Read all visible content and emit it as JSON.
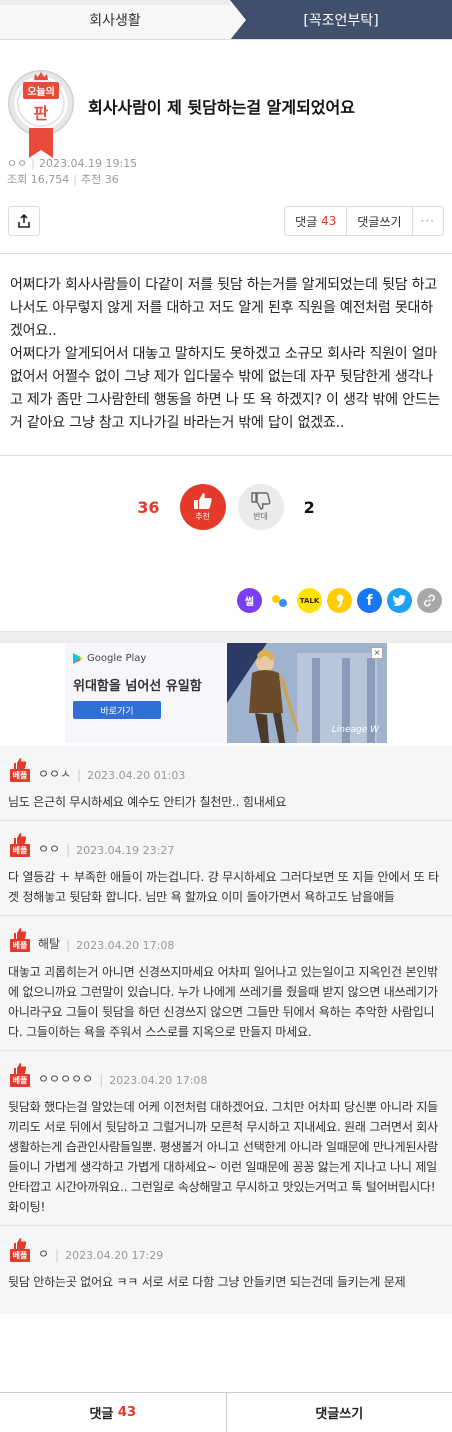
{
  "breadcrumb": {
    "category": "회사생활",
    "board": "[꼭조언부탁]"
  },
  "badge": {
    "line1": "오늘의",
    "line2": "판"
  },
  "post": {
    "title": "회사사람이 제 뒷담하는걸 알게되었어요",
    "author": "ㅇㅇ",
    "date": "2023.04.19 19:15",
    "views_label": "조회 16,754",
    "recommend_label": "추천 36",
    "body": "어쩌다가 회사사람들이 다같이 저를 뒷담 하는거를 알게되었는데 뒷담 하고 나서도 아무렇지 않게 저를 대하고 저도 알게 된후 직원을 예전처럼 못대하겠어요..\n어쩌다가 알게되어서 대놓고 말하지도 못하겠고 소규모 회사라 직원이 얼마 없어서 어쩔수 없이 그냥 제가 입다물수 밖에 없는데 자꾸 뒷담한게 생각나고 제가 좀만 그사람한테 행동을 하면 나 또 욕 하겠지? 이 생각 밖에 안드는거 같아요 그냥 참고 지나가길 바라는거 밖에 답이 없겠죠.."
  },
  "actions": {
    "comment_label": "댓글",
    "comment_count": "43",
    "write_label": "댓글쓰기",
    "more": "···"
  },
  "vote": {
    "up_count": "36",
    "up_label": "추천",
    "down_label": "반대",
    "down_count": "2"
  },
  "share": {
    "ssul": "썰",
    "kakao_talk": "TALK",
    "facebook": "f"
  },
  "ad": {
    "store": "Google Play",
    "headline": "위대함을 넘어선 유일함",
    "cta": "바로가기",
    "game": "Lineage W"
  },
  "best_tag": "베플",
  "comments": [
    {
      "nick": "ㅇㅇㅅ",
      "date": "2023.04.20 01:03",
      "text": "님도 은근히 무시하세요 예수도 안티가 칠천만.. 힘내세요"
    },
    {
      "nick": "ㅇㅇ",
      "date": "2023.04.19 23:27",
      "text": "다 열등감 ＋ 부족한 애들이 까는겁니다. 걍 무시하세요 그러다보면 또 지들 안에서 또 타겟 정해놓고 뒷담화 합니다. 님만 욕 할까요 이미 돌아가면서 욕하고도 남을애들"
    },
    {
      "nick": "해탈",
      "date": "2023.04.20 17:08",
      "text": "대놓고 괴롭히는거 아니면 신경쓰지마세요 어차피 일어나고 있는일이고 지옥인건 본인밖에 없으니까요 그런말이 있습니다. 누가 나에게 쓰레기를 줬을때 받지 않으면 내쓰레기가 아니라구요 그들이 뒷담을 하던 신경쓰지 않으면 그들만 뒤에서 욕하는 추악한 사람입니다. 그들이하는 욕을 주워서 스스로를 지옥으로 만들지 마세요."
    },
    {
      "nick": "ㅇㅇㅇㅇㅇ",
      "date": "2023.04.20 17:08",
      "text": "뒷담화 했다는걸 알았는데 어케 이전처럼 대하겠어요. 그치만 어차피 당신뿐 아니라 지들끼리도 서로 뒤에서 뒷담하고 그럴거니까 모른척 무시하고 지내세요. 원래 그러면서 회사생활하는게 습관인사람들일뿐. 평생볼거 아니고 선택한게 아니라 일때문에 만나게된사람들이니 가볍게 생각하고 가볍게 대하세요~ 이런 일때문에 꽁꽁 앓는게 지나고 나니 제일 안타깝고 시간아까워요.. 그런일로 속상해말고 무시하고 맛있는거먹고 툭 털어버립시다! 화이팅!"
    },
    {
      "nick": "ㅇ",
      "date": "2023.04.20 17:29",
      "text": "뒷담 안하는곳 없어요 ㅋㅋ 서로 서로 다함 그냥 안들키면 되는건데 들키는게 문제"
    }
  ],
  "bottom": {
    "comment_label": "댓글",
    "comment_count": "43",
    "write_label": "댓글쓰기"
  }
}
